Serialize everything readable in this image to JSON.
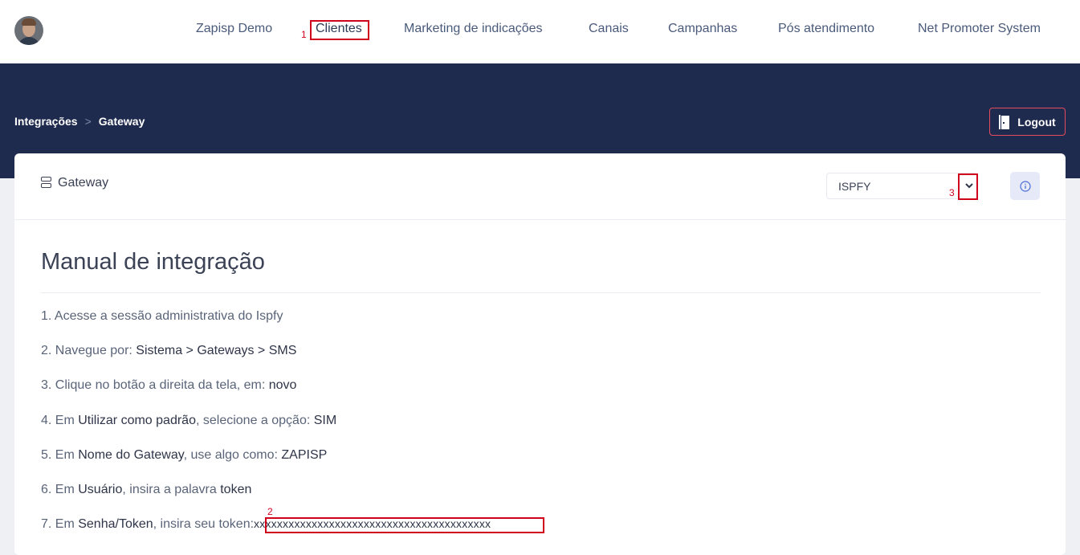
{
  "nav": {
    "items": [
      "Zapisp Demo",
      "Clientes",
      "Marketing de indicações",
      "Canais",
      "Campanhas",
      "Pós atendimento",
      "Net Promoter System"
    ]
  },
  "annotations": [
    "1",
    "2",
    "3"
  ],
  "breadcrumb": {
    "parent": "Integrações",
    "separator": ">",
    "current": "Gateway"
  },
  "logout": {
    "label": "Logout"
  },
  "card": {
    "title": "Gateway",
    "select_value": "ISPFY"
  },
  "manual": {
    "title": "Manual de integração",
    "steps": [
      {
        "prefix": "1. Acesse a sessão administrativa do Ispfy"
      },
      {
        "prefix": "2. Navegue por: ",
        "bold": "Sistema > Gateways > SMS"
      },
      {
        "prefix": "3. Clique no botão a direita da tela, em: ",
        "bold": "novo"
      },
      {
        "prefix": "4. Em ",
        "bold": "Utilizar como padrão",
        "middle": ", selecione a opção: ",
        "bold2": "SIM"
      },
      {
        "prefix": "5. Em ",
        "bold": "Nome do Gateway",
        "middle": ", use algo como: ",
        "bold2": "ZAPISP"
      },
      {
        "prefix": "6. Em ",
        "bold": "Usuário",
        "middle": ", insira a palavra ",
        "bold2": "token"
      },
      {
        "prefix": "7. Em ",
        "bold": "Senha/Token",
        "middle": ", insira seu token:",
        "token": "xxxxxxxxxxxxxxxxxxxxxxxxxxxxxxxxxxxxxxxxx"
      }
    ]
  },
  "colors": {
    "banner": "#1f2b4e",
    "accent_red": "#d0021b",
    "logout_border": "#e64a5d"
  }
}
